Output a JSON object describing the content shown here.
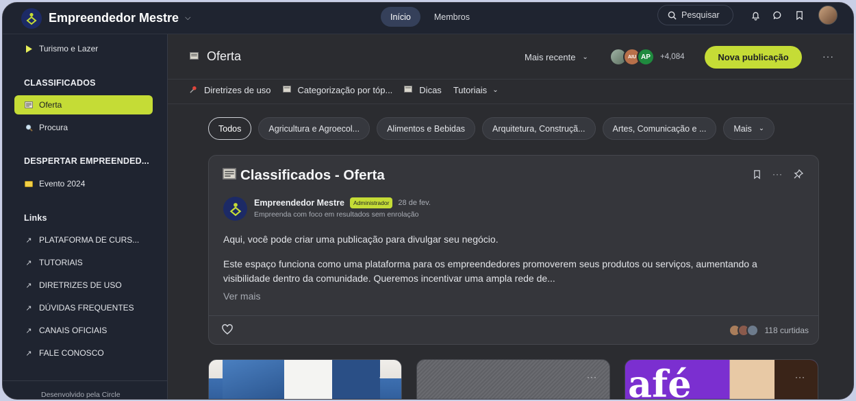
{
  "app": {
    "name": "Empreendedor Mestre"
  },
  "topnav": {
    "tabs": [
      {
        "label": "Início",
        "active": true
      },
      {
        "label": "Membros",
        "active": false
      }
    ]
  },
  "search": {
    "label": "Pesquisar"
  },
  "sidebar": {
    "top_item": "Turismo e Lazer",
    "section_classificados": "CLASSIFICADOS",
    "classificados_items": [
      {
        "label": "Oferta",
        "active": true,
        "icon": "newspaper-icon"
      },
      {
        "label": "Procura",
        "active": false,
        "icon": "magnifier-icon"
      }
    ],
    "section_despertar": "DESPERTAR EMPREENDED...",
    "despertar_items": [
      {
        "label": "Evento 2024",
        "icon": "ticket-icon"
      }
    ],
    "section_links": "Links",
    "links": [
      "PLATAFORMA DE CURS...",
      "TUTORIAIS",
      "DIRETRIZES DE USO",
      "DÚVIDAS FREQUENTES",
      "CANAIS OFICIAIS",
      "FALE CONOSCO"
    ],
    "footer": "Desenvolvido pela Circle"
  },
  "header": {
    "title": "Oferta",
    "sort": "Mais recente",
    "member_initials": "AP",
    "member_partial_initials": "AIU",
    "member_count": "+4,084",
    "new_post": "Nova publicação"
  },
  "subnav": [
    {
      "label": "Diretrizes de uso",
      "icon": "pushpin-icon"
    },
    {
      "label": "Categorização por tóp...",
      "icon": "newspaper-icon"
    },
    {
      "label": "Dicas",
      "icon": "newspaper-icon"
    },
    {
      "label": "Tutoriais",
      "icon": "chevron-down-icon"
    }
  ],
  "chips": [
    "Todos",
    "Agricultura e Agroecol...",
    "Alimentos e Bebidas",
    "Arquitetura, Construçã...",
    "Artes, Comunicação e ...",
    "Mais"
  ],
  "post": {
    "title": "Classificados - Oferta",
    "author": "Empreendedor Mestre",
    "badge": "Administrador",
    "date": "28 de fev.",
    "author_tagline": "Empreenda com foco em resultados sem enrolação",
    "p1": "Aqui, você pode criar uma publicação para divulgar seu negócio.",
    "p2": "Este espaço funciona como uma plataforma para os empreendedores promoverem seus produtos ou serviços, aumentando a visibilidade dentro da comunidade. Queremos incentivar uma ampla rede de...",
    "read_more": "Ver mais",
    "likes": "118 curtidas"
  },
  "colors": {
    "accent": "#c5dc36",
    "sidebar_bg": "#1f2430",
    "main_bg": "#2b2c30",
    "card_bg": "#35363b"
  }
}
